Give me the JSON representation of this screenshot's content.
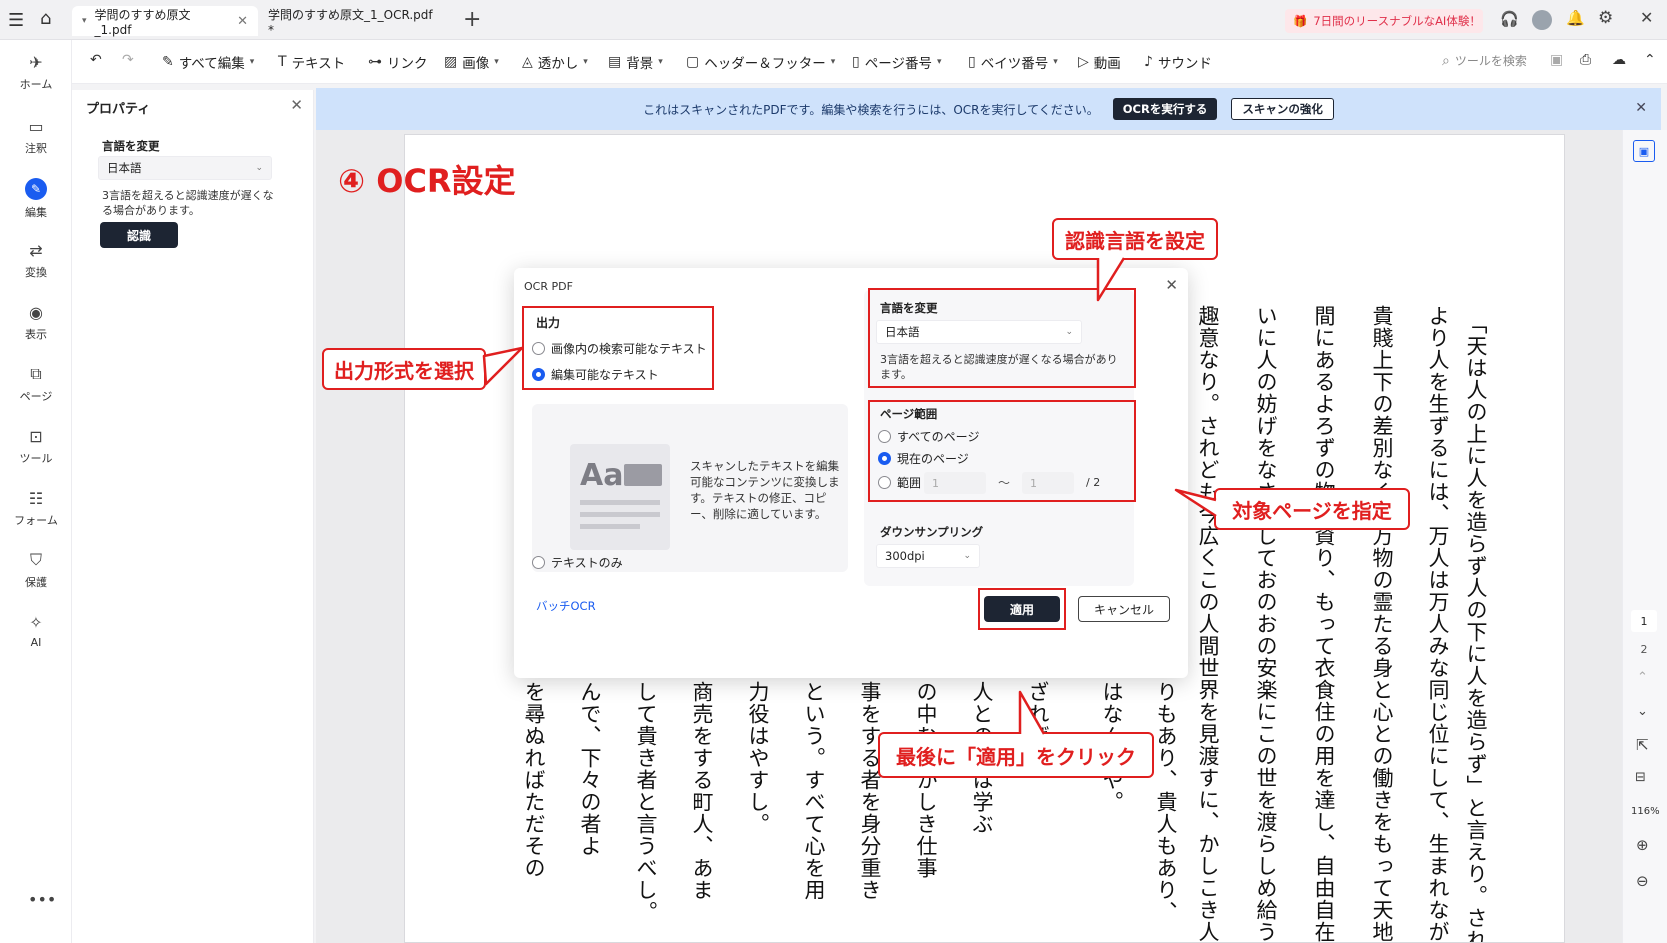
{
  "tabs": [
    {
      "label": "学問のすすめ原文_1.pdf",
      "active": true
    },
    {
      "label": "学問のすすめ原文_1_OCR.pdf *",
      "active": false
    }
  ],
  "promo": "7日間のリースナブルなAI体験！",
  "rail": [
    "ホーム",
    "注釈",
    "編集",
    "変換",
    "表示",
    "ページ",
    "ツール",
    "フォーム",
    "保護",
    "AI"
  ],
  "toolbar": {
    "edit_all": "すべて編集",
    "text": "テキスト",
    "link": "リンク",
    "image": "画像",
    "watermark": "透かし",
    "background": "背景",
    "header_footer": "ヘッダー＆フッター",
    "page_number": "ページ番号",
    "bates": "ベイツ番号",
    "video": "動画",
    "sound": "サウンド",
    "search_tools": "ツールを検索"
  },
  "props": {
    "title": "プロパティ",
    "lang_label": "言語を変更",
    "lang_value": "日本語",
    "note": "3言語を超えると認識速度が遅くなる場合があります。",
    "recognize": "認識"
  },
  "banner": {
    "message": "これはスキャンされたPDFです。編集や検索を行うには、OCRを実行してください。",
    "ocr_btn": "OCRを実行する",
    "enhance_btn": "スキャンの強化"
  },
  "step_title": "④ OCR設定",
  "dialog": {
    "title": "OCR PDF",
    "output_label": "出力",
    "opt_searchable": "画像内の検索可能なテキスト",
    "opt_editable": "編集可能なテキスト",
    "preview_desc": "スキャンしたテキストを編集可能なコンテンツに変換します。テキストの修正、コピー、削除に適しています。",
    "preview_aa": "Aa",
    "opt_text_only": "テキストのみ",
    "lang_label": "言語を変更",
    "lang_value": "日本語",
    "lang_note": "3言語を超えると認識速度が遅くなる場合があります。",
    "range_label": "ページ範囲",
    "opt_all_pages": "すべてのページ",
    "opt_current_page": "現在のページ",
    "opt_range": "範囲",
    "range_from": "1",
    "range_to": "1",
    "range_sep": "～",
    "range_total": "/ 2",
    "downsample_label": "ダウンサンプリング",
    "downsample_value": "300dpi",
    "batch_link": "バッチOCR",
    "apply": "適用",
    "cancel": "キャンセル"
  },
  "callouts": {
    "output": "出力形式を選択",
    "language": "認識言語を設定",
    "pages": "対象ページを指定",
    "apply": "最後に「適用」をクリック"
  },
  "doc_columns": [
    "「天は人の上に人を造らず人の下に人を造らず」と言えり。されば天",
    "より人を生ずるには、万人は万人みな同じ位にして、生まれながら",
    "貴賤上下の差別なく、万物の霊たる身と心との働きをもって天地の",
    "間にあるよろずの物を資り、もって衣食住の用を達し、自由自在、互",
    "いに人の妨げをなさずしておのおの安楽にこの世を渡らしめ給うの",
    "趣意なり。されども今広くこの人間世界を見渡すに、かしこき人あ"
  ],
  "doc_columns_lower": [
    "りもあり、貴人もあり、",
    "はなんぞや。",
    "ざれば智",
    "人との別は学ぶ",
    "の中むずかしき仕事",
    "事をする者を身分重き",
    "という。すべて心を用",
    "力役はやすし。",
    "商売をする町人、あま",
    "して貴き者と言うべし。",
    "んで、下々の者よ",
    "を尋ぬればただその"
  ],
  "page_nav": [
    "1",
    "2"
  ],
  "zoom": "116%"
}
